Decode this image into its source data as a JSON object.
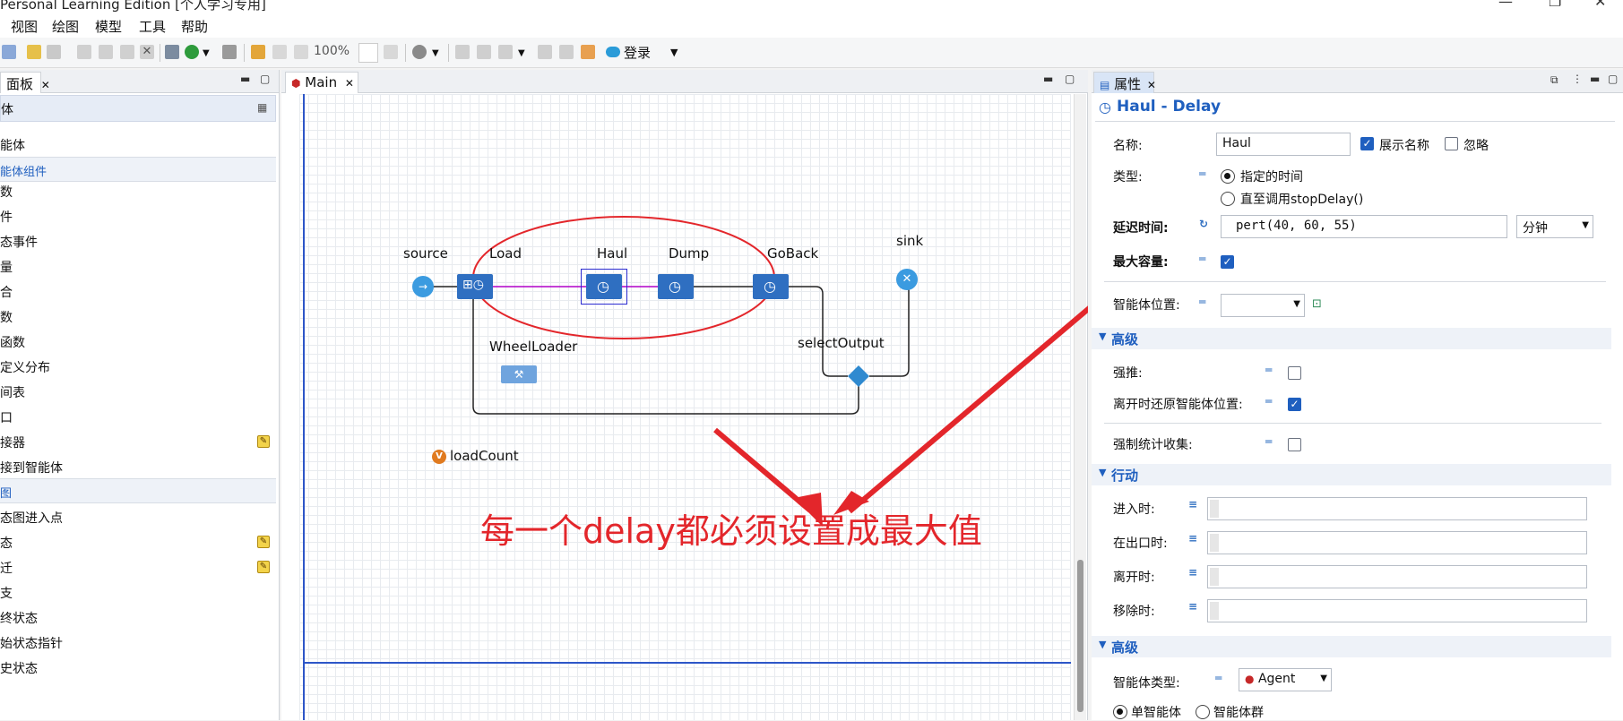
{
  "window": {
    "title": "Personal Learning Edition [个人学习专用]",
    "controls": [
      "—",
      "❐",
      "✕"
    ]
  },
  "menu": [
    "视图",
    "绘图",
    "模型",
    "工具",
    "帮助"
  ],
  "toolbar": {
    "zoom": "100%",
    "login_label": "登录"
  },
  "palette": {
    "tab": "面板",
    "header": "体",
    "items_top": [
      "能体"
    ],
    "section1": "能体组件",
    "section1_items": [
      "数",
      "件",
      "态事件",
      "量",
      "合",
      "数",
      "函数",
      "定义分布",
      "间表",
      "口",
      "接器",
      "接到智能体"
    ],
    "section2": "图",
    "section2_items": [
      "态图进入点",
      "态",
      "迁",
      "支",
      "终状态",
      "始状态指针",
      "史状态"
    ]
  },
  "editor": {
    "tab": "Main",
    "nodes": {
      "source": "source",
      "load": "Load",
      "haul": "Haul",
      "dump": "Dump",
      "goback": "GoBack",
      "sink": "sink",
      "wheelloader": "WheelLoader",
      "selectoutput": "selectOutput",
      "loadcount": "loadCount",
      "variable_badge": "V"
    },
    "annotation": "每一个delay都必须设置成最大值"
  },
  "properties": {
    "tab": "属性",
    "title": "Haul - Delay",
    "name_label": "名称:",
    "name_value": "Haul",
    "show_name": "展示名称",
    "show_name_checked": true,
    "ignore": "忽略",
    "ignore_checked": false,
    "type_label": "类型:",
    "type_opt1": "指定的时间",
    "type_opt2": "直至调用stopDelay()",
    "delay_label": "延迟时间:",
    "delay_value": "pert(40, 60, 55)",
    "delay_unit": "分钟",
    "maxcap_label": "最大容量:",
    "maxcap_checked": true,
    "agentloc_label": "智能体位置:",
    "sec_advanced": "高级",
    "push_label": "强推:",
    "push_checked": false,
    "restore_label": "离开时还原智能体位置:",
    "restore_checked": true,
    "stats_label": "强制统计收集:",
    "stats_checked": false,
    "sec_actions": "行动",
    "on_enter": "进入时:",
    "on_exit_port": "在出口时:",
    "on_leave": "离开时:",
    "on_remove": "移除时:",
    "sec_advanced2": "高级",
    "agent_type_label": "智能体类型:",
    "agent_type_value": "Agent",
    "single_agent": "单智能体",
    "population": "智能体群"
  },
  "colors": {
    "accent": "#1f5fbf",
    "block": "#2f6fc1",
    "annotation": "#e3262b",
    "flow": "#b000c8"
  }
}
